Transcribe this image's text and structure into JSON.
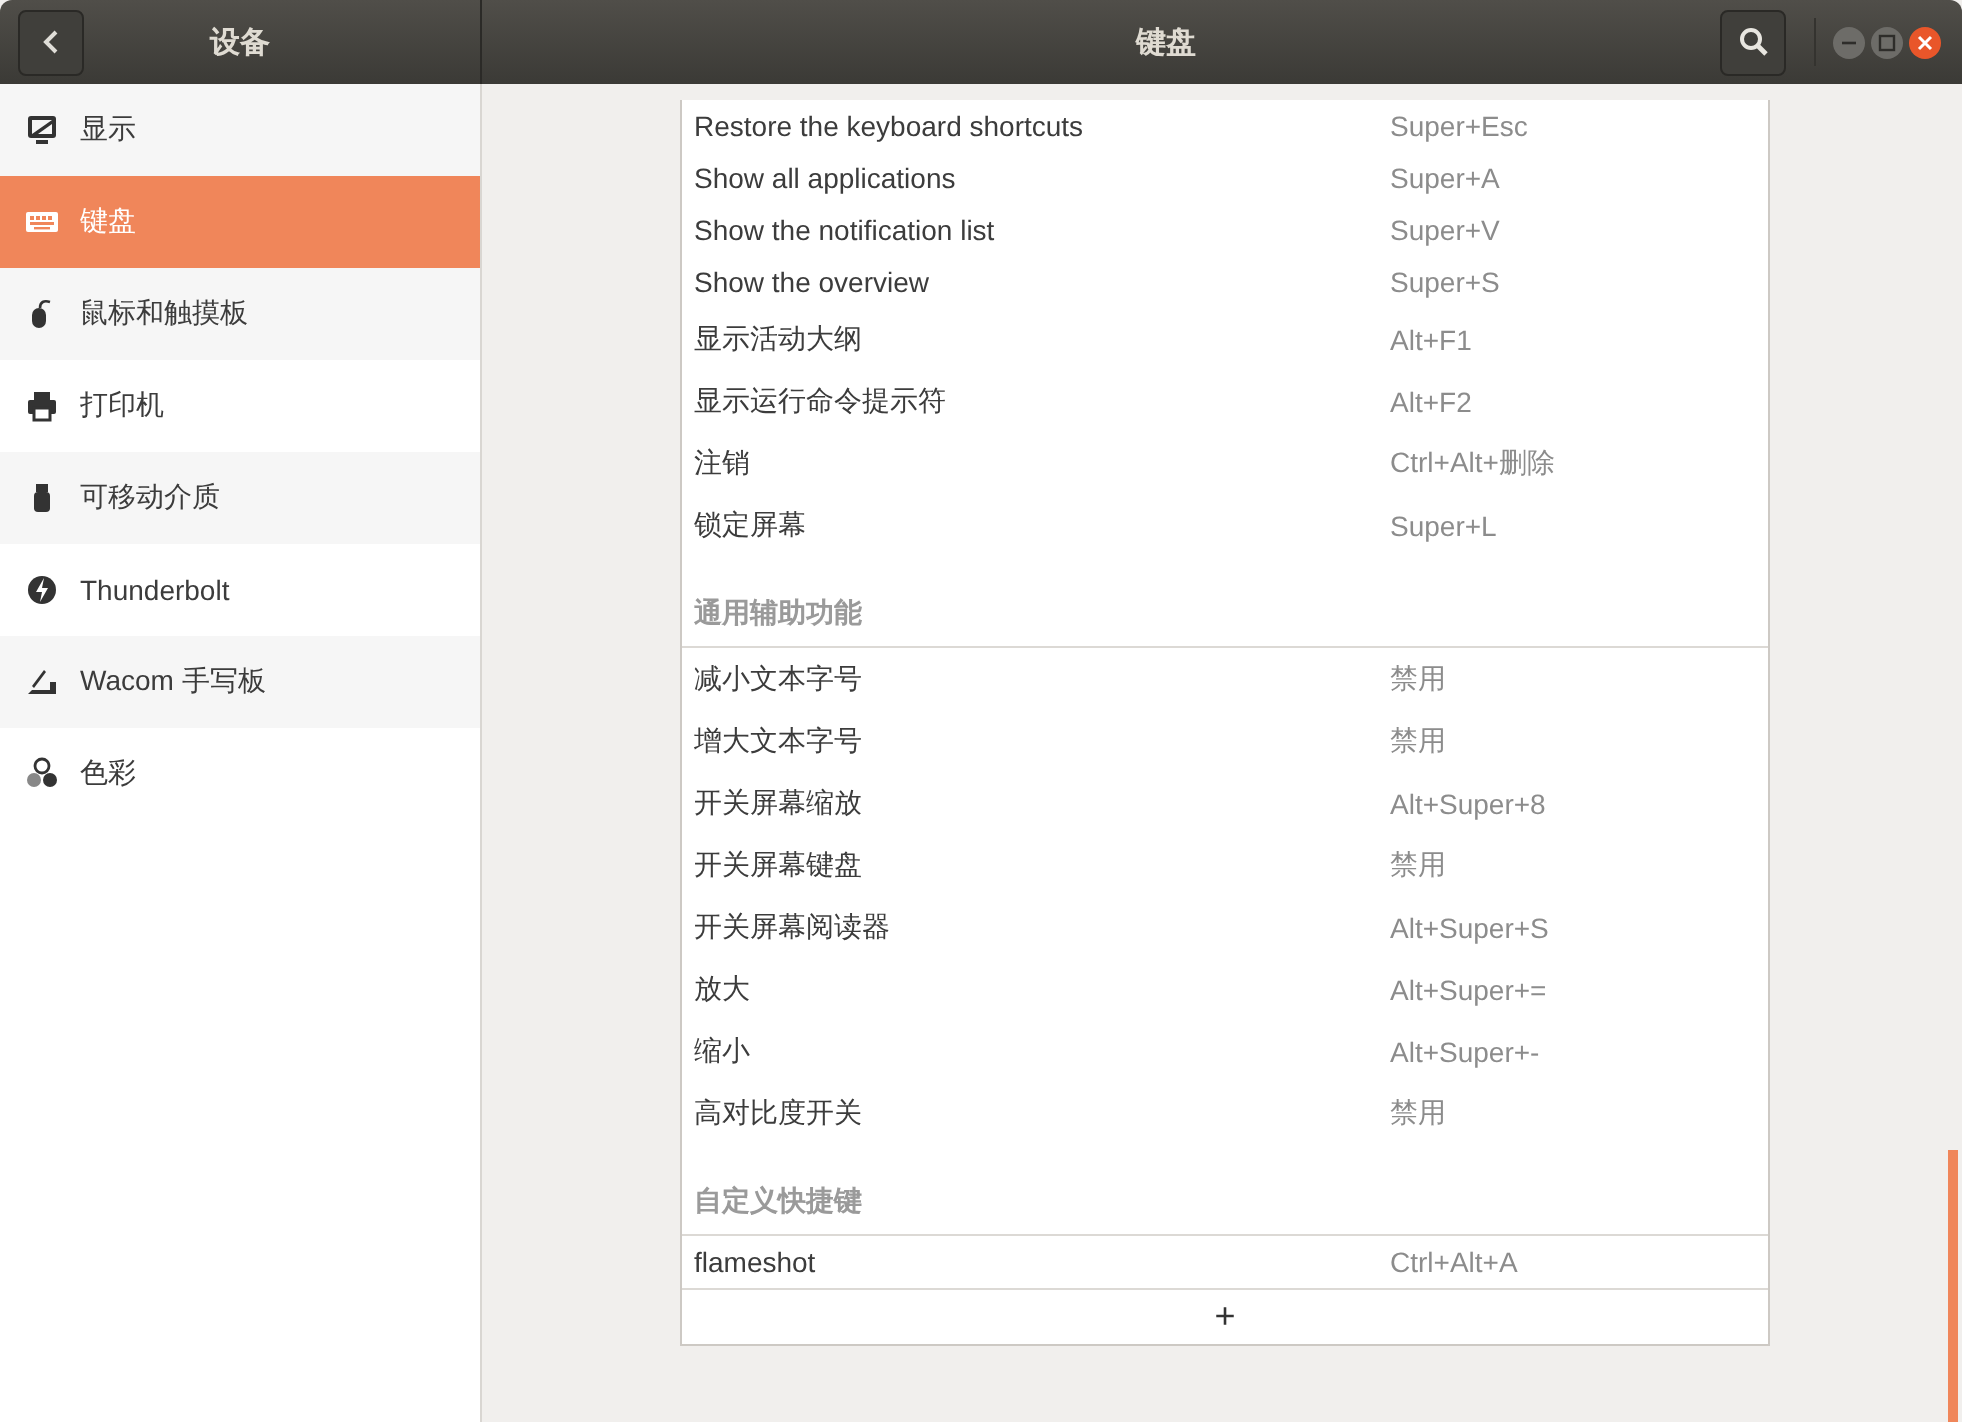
{
  "sidebar": {
    "title": "设备",
    "items": [
      {
        "label": "显示",
        "kind": "display",
        "selected": false
      },
      {
        "label": "键盘",
        "kind": "keyboard",
        "selected": true
      },
      {
        "label": "鼠标和触摸板",
        "kind": "mouse",
        "selected": false
      },
      {
        "label": "打印机",
        "kind": "printer",
        "selected": false
      },
      {
        "label": "可移动介质",
        "kind": "usb",
        "selected": false
      },
      {
        "label": "Thunderbolt",
        "kind": "bolt",
        "selected": false
      },
      {
        "label": "Wacom 手写板",
        "kind": "tablet",
        "selected": false
      },
      {
        "label": "色彩",
        "kind": "color",
        "selected": false
      }
    ]
  },
  "window": {
    "title": "键盘"
  },
  "sections": [
    {
      "rows": [
        {
          "name": "Restore the keyboard shortcuts",
          "shortcut": "Super+Esc",
          "kind": "latin"
        },
        {
          "name": "Show all applications",
          "shortcut": "Super+A",
          "kind": "latin"
        },
        {
          "name": "Show the notification list",
          "shortcut": "Super+V",
          "kind": "latin"
        },
        {
          "name": "Show the overview",
          "shortcut": "Super+S",
          "kind": "latin"
        },
        {
          "name": "显示活动大纲",
          "shortcut": "Alt+F1",
          "kind": "cjk"
        },
        {
          "name": "显示运行命令提示符",
          "shortcut": "Alt+F2",
          "kind": "cjk"
        },
        {
          "name": "注销",
          "shortcut": "Ctrl+Alt+删除",
          "kind": "cjk"
        },
        {
          "name": "锁定屏幕",
          "shortcut": "Super+L",
          "kind": "cjk"
        }
      ]
    },
    {
      "title": "通用辅助功能",
      "rows": [
        {
          "name": "减小文本字号",
          "shortcut": "禁用",
          "kind": "cjk"
        },
        {
          "name": "增大文本字号",
          "shortcut": "禁用",
          "kind": "cjk"
        },
        {
          "name": "开关屏幕缩放",
          "shortcut": "Alt+Super+8",
          "kind": "cjk"
        },
        {
          "name": "开关屏幕键盘",
          "shortcut": "禁用",
          "kind": "cjk"
        },
        {
          "name": "开关屏幕阅读器",
          "shortcut": "Alt+Super+S",
          "kind": "cjk"
        },
        {
          "name": "放大",
          "shortcut": "Alt+Super+=",
          "kind": "cjk"
        },
        {
          "name": "缩小",
          "shortcut": "Alt+Super+-",
          "kind": "cjk"
        },
        {
          "name": "高对比度开关",
          "shortcut": "禁用",
          "kind": "cjk"
        }
      ]
    },
    {
      "title": "自定义快捷键",
      "rows": [
        {
          "name": "flameshot",
          "shortcut": "Ctrl+Alt+A",
          "kind": "custom"
        }
      ],
      "add": "+"
    }
  ]
}
